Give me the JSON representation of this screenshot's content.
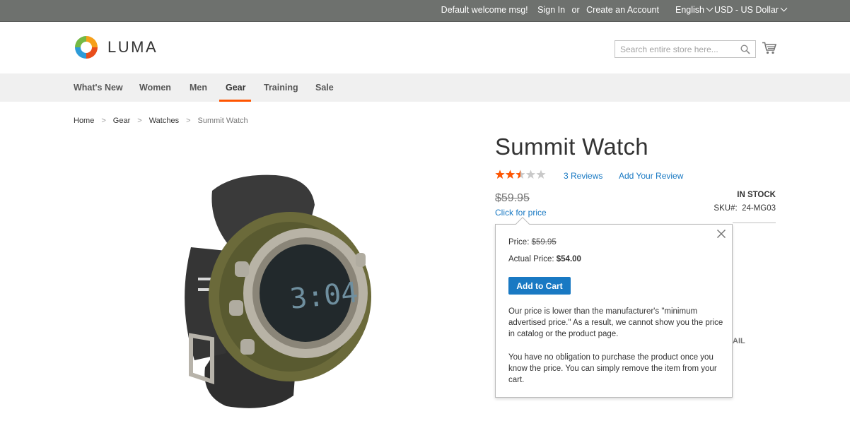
{
  "topbar": {
    "welcome": "Default welcome msg!",
    "sign_in": "Sign In",
    "or": "or",
    "create_account": "Create an Account",
    "language": "English",
    "currency": "USD - US Dollar"
  },
  "header": {
    "logo_text": "LUMA",
    "search_placeholder": "Search entire store here...",
    "search_icon": "search-icon",
    "cart_icon": "cart-icon"
  },
  "nav": {
    "items": [
      "What's New",
      "Women",
      "Men",
      "Gear",
      "Training",
      "Sale"
    ],
    "active": "Gear",
    "accent_color": "#ff5501"
  },
  "breadcrumbs": {
    "items": [
      "Home",
      "Gear",
      "Watches"
    ],
    "current": "Summit Watch",
    "separator": ">"
  },
  "product": {
    "name": "Summit Watch",
    "rating": {
      "value": 2.5,
      "max": 5
    },
    "reviews_link": "3 Reviews",
    "add_review_link": "Add Your Review",
    "old_price": "$59.95",
    "click_for_price": "Click for price",
    "stock": "IN STOCK",
    "sku_label": "SKU#:",
    "sku_value": "24-MG03",
    "partial_text_behind_popup": "AIL"
  },
  "popup": {
    "price_label": "Price:",
    "price_value": "$59.95",
    "actual_price_label": "Actual Price:",
    "actual_price_value": "$54.00",
    "add_to_cart": "Add to Cart",
    "paragraph1": "Our price is lower than the manufacturer's \"minimum advertised price.\" As a result, we cannot show you the price in catalog or the product page.",
    "paragraph2": "You have no obligation to purchase the product once you know the price. You can simply remove the item from your cart.",
    "close_icon": "close-icon",
    "button_color": "#1979c3"
  },
  "colors": {
    "topbar_bg": "#6e716e",
    "nav_bg": "#f0f0f0",
    "link": "#1979c3",
    "star": "#ff5501"
  }
}
